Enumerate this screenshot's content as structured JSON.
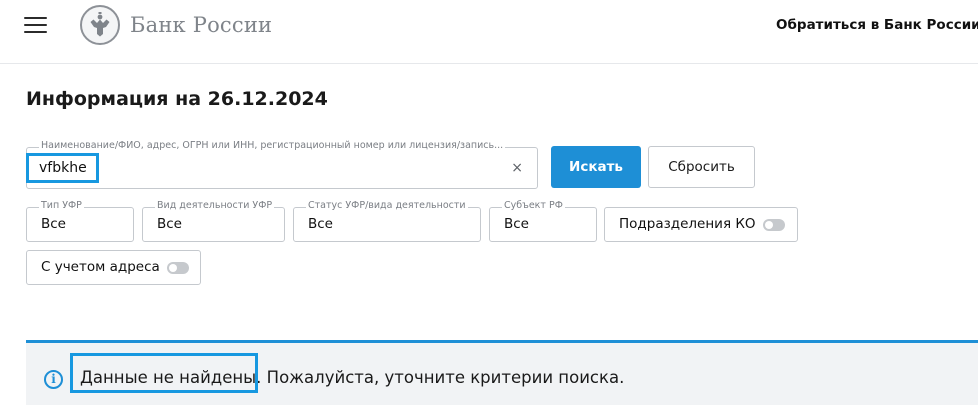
{
  "header": {
    "logo_text": "Банк России",
    "contact_link": "Обратиться в Банк России"
  },
  "page": {
    "title": "Информация на 26.12.2024"
  },
  "search": {
    "label": "Наименование/ФИО, адрес, ОГРН или ИНН, регистрационный номер или лицензия/запись...",
    "value": "vfbkhe",
    "clear_icon": "×",
    "search_button": "Искать",
    "reset_button": "Сбросить"
  },
  "filters": [
    {
      "label": "Тип УФР",
      "value": "Все"
    },
    {
      "label": "Вид деятельности УФР",
      "value": "Все"
    },
    {
      "label": "Статус УФР/вида деятельности",
      "value": "Все"
    },
    {
      "label": "Субъект РФ",
      "value": "Все"
    }
  ],
  "toggles": {
    "branches": {
      "label": "Подразделения КО",
      "on": false
    },
    "address": {
      "label": "С учетом адреса",
      "on": false
    }
  },
  "result": {
    "icon": "i",
    "message_main": "Данные не найдены.",
    "message_rest": " Пожалуйста, уточните критерии поиска."
  },
  "colors": {
    "accent": "#1e8fd6",
    "highlight": "#1798e0",
    "banner_bg": "#f1f3f5"
  }
}
